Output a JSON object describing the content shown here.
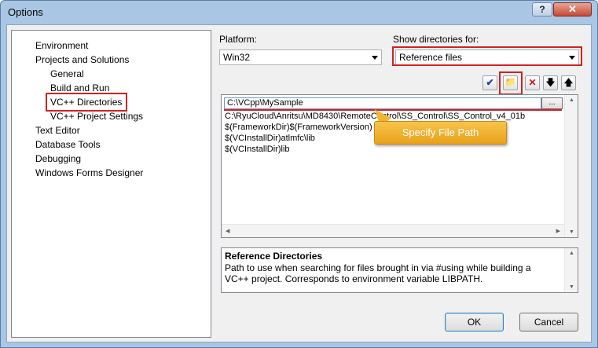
{
  "window": {
    "title": "Options",
    "help_label": "?",
    "close_label": "✕"
  },
  "tree": {
    "items": [
      "Environment",
      "Projects and Solutions",
      "General",
      "Build and Run",
      "VC++ Directories",
      "VC++ Project Settings",
      "Text Editor",
      "Database Tools",
      "Debugging",
      "Windows Forms Designer"
    ],
    "selected": "VC++ Directories"
  },
  "platform": {
    "label": "Platform:",
    "value": "Win32"
  },
  "show_dirs": {
    "label": "Show directories for:",
    "value": "Reference files"
  },
  "toolbar": {
    "check_icon": "✔",
    "folder_icon": "📁",
    "delete_icon": "✕",
    "down_icon": "🡇",
    "up_icon": "🡅"
  },
  "directories": {
    "editing_value": "C:\\VCpp\\MySample",
    "browse_label": "...",
    "rows": [
      "C:\\RyuCloud\\Anritsu\\MD8430\\RemoteControl\\SS_Control\\SS_Control_v4_01b",
      "$(FrameworkDir)$(FrameworkVersion)",
      "$(VCInstallDir)atlmfc\\lib",
      "$(VCInstallDir)lib"
    ]
  },
  "callout": {
    "text": "Specify File Path"
  },
  "description": {
    "title": "Reference Directories",
    "text": "Path to use when searching for files brought in via #using while building a VC++ project.  Corresponds to environment variable LIBPATH."
  },
  "buttons": {
    "ok": "OK",
    "cancel": "Cancel"
  },
  "colors": {
    "highlight_red": "#d42020",
    "callout_orange": "#f1b532"
  }
}
